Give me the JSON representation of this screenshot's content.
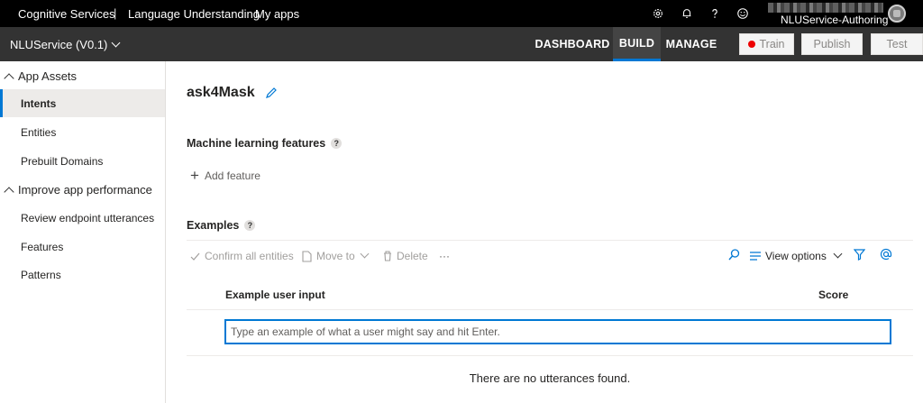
{
  "topbar": {
    "crumbs": [
      "Cognitive Services",
      "Language Understanding",
      "My apps"
    ],
    "separator": "|",
    "account_name": "NLUService-Authoring",
    "icons": [
      "gear-icon",
      "bell-icon",
      "help-icon",
      "smiley-icon",
      "avatar"
    ]
  },
  "appbar": {
    "app_name": "NLUService (V0.1)",
    "tabs": [
      {
        "label": "DASHBOARD",
        "active": false
      },
      {
        "label": "BUILD",
        "active": true
      },
      {
        "label": "MANAGE",
        "active": false
      }
    ],
    "train_label": "Train",
    "publish_label": "Publish",
    "test_label": "Test",
    "train_status_color": "#e00000",
    "accent": "#0078d4"
  },
  "sidebar": {
    "group1": "App Assets",
    "group1_items": [
      "Intents",
      "Entities",
      "Prebuilt Domains"
    ],
    "group2": "Improve app performance",
    "group2_items": [
      "Review endpoint utterances",
      "Features",
      "Patterns"
    ],
    "selected": "Intents"
  },
  "main": {
    "intent_name": "ask4Mask",
    "ml_features_title": "Machine learning features",
    "help_glyph": "?",
    "add_feature_label": "Add feature",
    "examples_title": "Examples",
    "toolbar": {
      "confirm_all": "Confirm all entities",
      "move_to": "Move to",
      "delete": "Delete",
      "more": "···",
      "view_options": "View options"
    },
    "columns": {
      "input": "Example user input",
      "score": "Score"
    },
    "input_placeholder": "Type an example of what a user might say and hit Enter.",
    "empty_message": "There are no utterances found."
  }
}
